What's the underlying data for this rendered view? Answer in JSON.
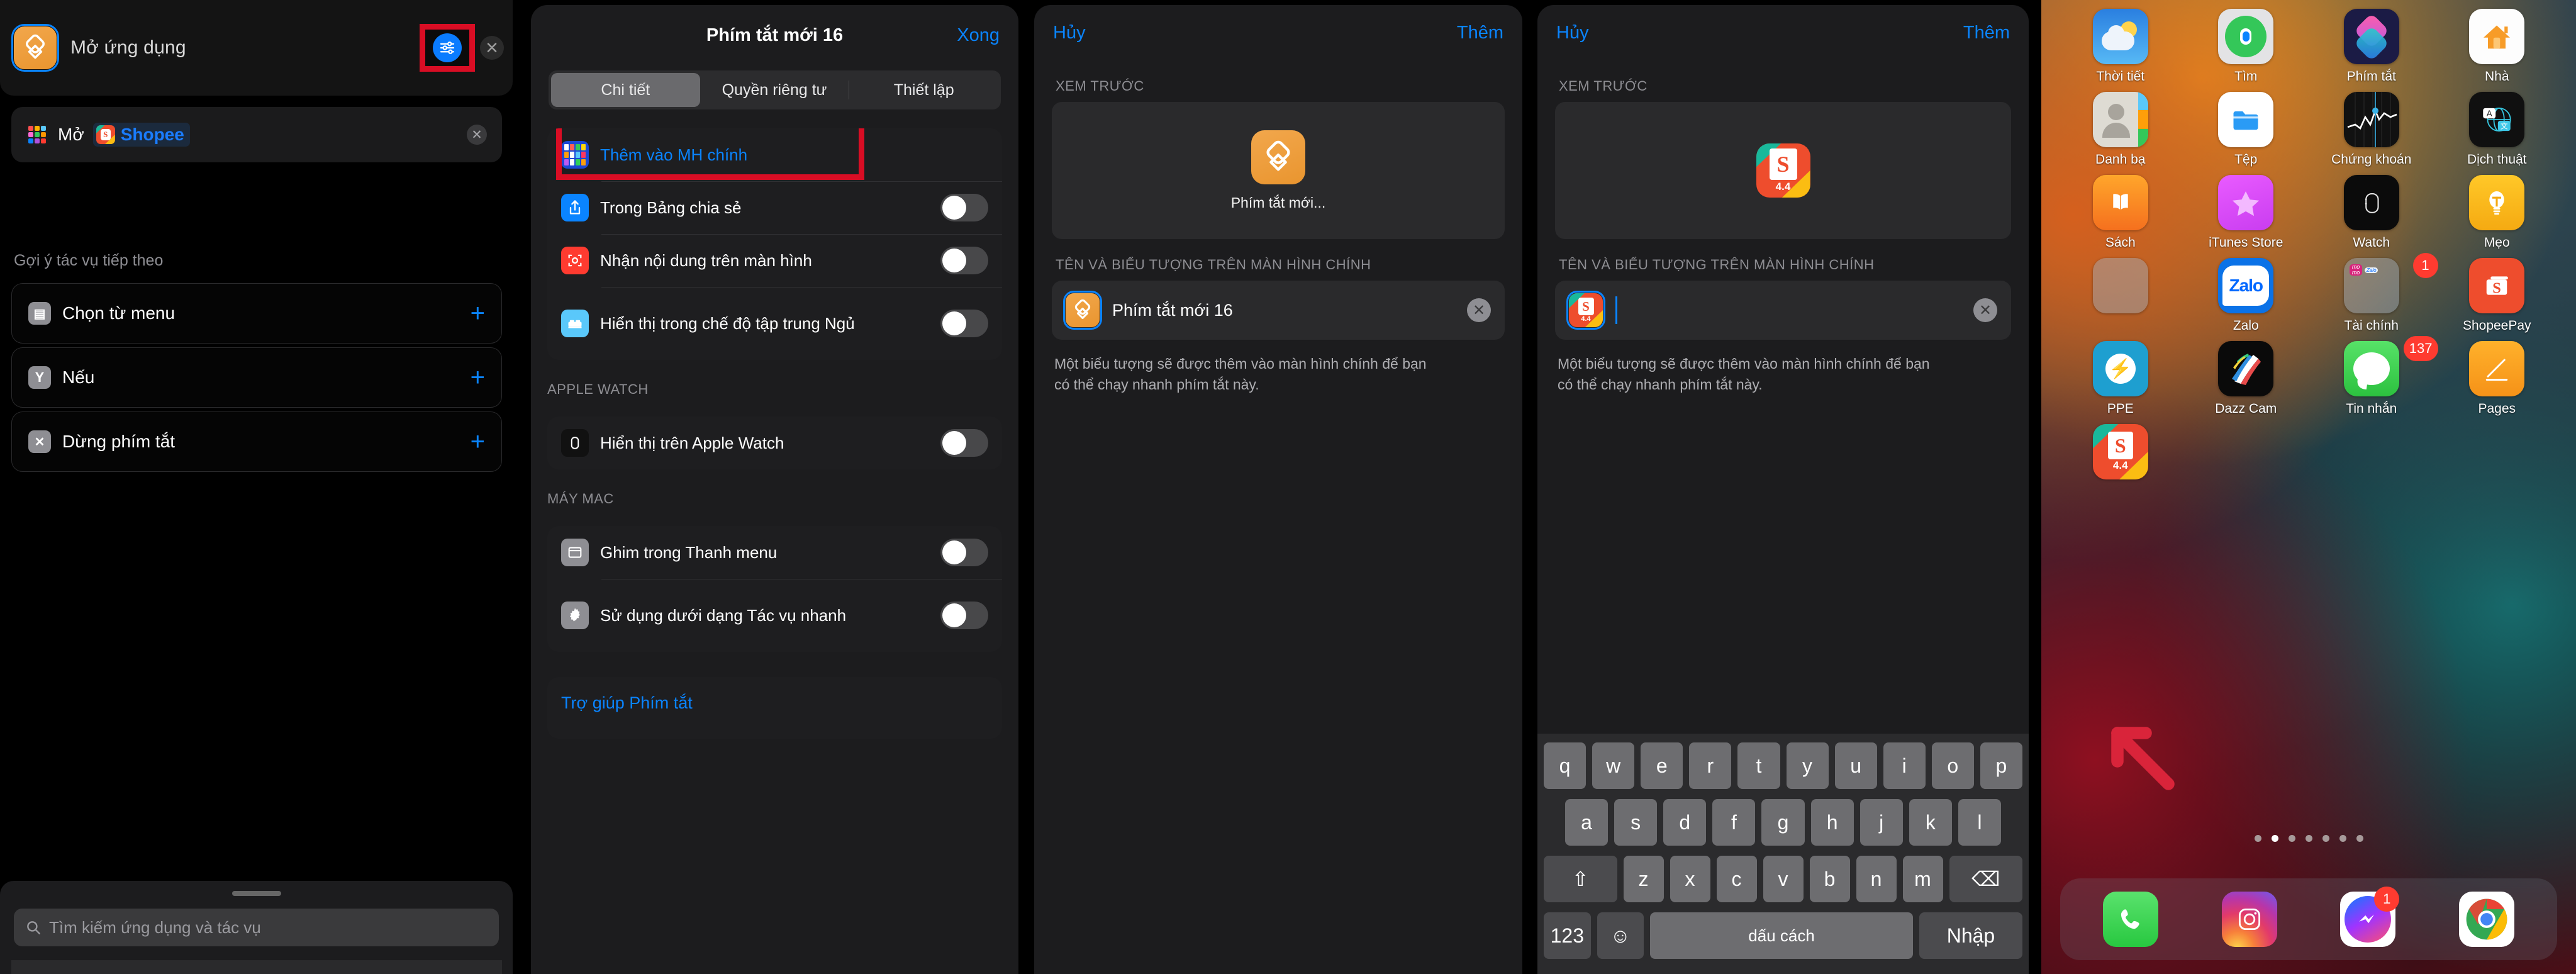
{
  "panel1": {
    "action_title": "Mở ứng dụng",
    "filter_icon": "sliders-icon",
    "close_icon": "close-icon",
    "param_row": {
      "grid_icon": "app-grid-icon",
      "label": "Mở",
      "app_token": "Shopee",
      "clear_icon": "clear-icon"
    },
    "suggestions_header": "Gợi ý tác vụ tiếp theo",
    "suggestions": [
      {
        "label": "Chọn từ menu",
        "icon": "menu-icon",
        "add": "+"
      },
      {
        "label": "Nếu",
        "icon": "if-icon",
        "add": "+"
      },
      {
        "label": "Dừng phím tắt",
        "icon": "stop-icon",
        "add": "+"
      }
    ],
    "search_placeholder": "Tìm kiếm ứng dụng và tác vụ",
    "search_icon": "search-icon"
  },
  "panel2": {
    "title": "Phím tắt mới 16",
    "done": "Xong",
    "tabs": [
      {
        "label": "Chi tiết",
        "selected": true
      },
      {
        "label": "Quyền riêng tư",
        "selected": false
      },
      {
        "label": "Thiết lập",
        "selected": false
      }
    ],
    "group1": [
      {
        "label": "Thêm vào MH chính",
        "icon": "home-screen-icon",
        "type": "link",
        "highlighted": true
      },
      {
        "label": "Trong Bảng chia sẻ",
        "icon": "share-icon",
        "type": "toggle",
        "on": false
      },
      {
        "label": "Nhận nội dung trên màn hình",
        "icon": "screen-capture-icon",
        "type": "toggle",
        "on": false
      },
      {
        "label": "Hiển thị trong chế độ tập trung Ngủ",
        "icon": "bed-icon",
        "type": "toggle",
        "on": false
      }
    ],
    "watch_header": "APPLE WATCH",
    "watch_rows": [
      {
        "label": "Hiển thị trên Apple Watch",
        "icon": "apple-watch-icon",
        "type": "toggle",
        "on": false
      }
    ],
    "mac_header": "MÁY MAC",
    "mac_rows": [
      {
        "label": "Ghim trong Thanh menu",
        "icon": "menubar-icon",
        "type": "toggle",
        "on": false
      },
      {
        "label": "Sử dụng dưới dạng Tác vụ nhanh",
        "icon": "gear-icon",
        "type": "toggle",
        "on": false
      }
    ],
    "help_link": "Trợ giúp Phím tắt"
  },
  "panel3": {
    "cancel": "Hủy",
    "add": "Thêm",
    "preview_header": "XEM TRƯỚC",
    "preview_caption": "Phím tắt mới...",
    "name_header": "TÊN VÀ BIỂU TƯỢNG TRÊN MÀN HÌNH CHÍNH",
    "name_value": "Phím tắt mới 16",
    "clear_icon": "clear-icon",
    "hint": "Một biểu tượng sẽ được thêm vào màn hình chính để bạn có thể chạy nhanh phím tắt này."
  },
  "panel4": {
    "cancel": "Hủy",
    "add": "Thêm",
    "preview_header": "XEM TRƯỚC",
    "name_header": "TÊN VÀ BIỂU TƯỢNG TRÊN MÀN HÌNH CHÍNH",
    "name_value": "",
    "clear_icon": "clear-icon",
    "hint": "Một biểu tượng sẽ được thêm vào màn hình chính để bạn có thể chạy nhanh phím tắt này.",
    "app_badge": "4.4",
    "keyboard": {
      "row1": [
        "q",
        "w",
        "e",
        "r",
        "t",
        "y",
        "u",
        "i",
        "o",
        "p"
      ],
      "row2": [
        "a",
        "s",
        "d",
        "f",
        "g",
        "h",
        "j",
        "k",
        "l"
      ],
      "row3": [
        "z",
        "x",
        "c",
        "v",
        "b",
        "n",
        "m"
      ],
      "shift": "⇧",
      "backspace": "⌫",
      "numbers": "123",
      "emoji": "☺",
      "space": "dấu cách",
      "enter": "Nhập"
    }
  },
  "panel5": {
    "apps": [
      {
        "name": "Thời tiết",
        "icon": "weather-icon",
        "badge": null
      },
      {
        "name": "Tìm",
        "icon": "find-my-icon",
        "badge": null
      },
      {
        "name": "Phím tắt",
        "icon": "shortcuts-icon",
        "badge": null
      },
      {
        "name": "Nhà",
        "icon": "home-icon",
        "badge": null
      },
      {
        "name": "Danh bạ",
        "icon": "contacts-icon",
        "badge": null
      },
      {
        "name": "Tệp",
        "icon": "files-icon",
        "badge": null
      },
      {
        "name": "Chứng khoán",
        "icon": "stocks-icon",
        "badge": null
      },
      {
        "name": "Dịch thuật",
        "icon": "translate-icon",
        "badge": null
      },
      {
        "name": "Sách",
        "icon": "books-icon",
        "badge": null
      },
      {
        "name": "iTunes Store",
        "icon": "itunes-store-icon",
        "badge": null
      },
      {
        "name": "Watch",
        "icon": "watch-app-icon",
        "badge": null
      },
      {
        "name": "Mẹo",
        "icon": "tips-icon",
        "badge": null
      },
      {
        "name": "",
        "icon": "utilities-folder-icon",
        "badge": null
      },
      {
        "name": "Zalo",
        "icon": "zalo-icon",
        "badge": null
      },
      {
        "name": "Tài chính",
        "icon": "finance-folder-icon",
        "badge": "1"
      },
      {
        "name": "ShopeePay",
        "icon": "shopeepay-icon",
        "badge": null
      },
      {
        "name": "PPE",
        "icon": "ppe-icon",
        "badge": null
      },
      {
        "name": "Dazz Cam",
        "icon": "dazz-cam-icon",
        "badge": null
      },
      {
        "name": "Tin nhắn",
        "icon": "messages-icon",
        "badge": "137"
      },
      {
        "name": "Pages",
        "icon": "pages-icon",
        "badge": null
      },
      {
        "name": "",
        "icon": "shopee-shortcut-icon",
        "badge": null
      }
    ],
    "shopee_version": "4.4",
    "page_dots": {
      "count": 7,
      "active_index": 1
    },
    "dock": [
      {
        "name": "Điện thoại",
        "icon": "phone-icon",
        "badge": null
      },
      {
        "name": "Instagram",
        "icon": "instagram-icon",
        "badge": null
      },
      {
        "name": "Messenger",
        "icon": "messenger-icon",
        "badge": "1"
      },
      {
        "name": "Chrome",
        "icon": "chrome-icon",
        "badge": null
      }
    ],
    "arrow_icon": "red-arrow-icon",
    "arrow_color": "#d9243a"
  }
}
